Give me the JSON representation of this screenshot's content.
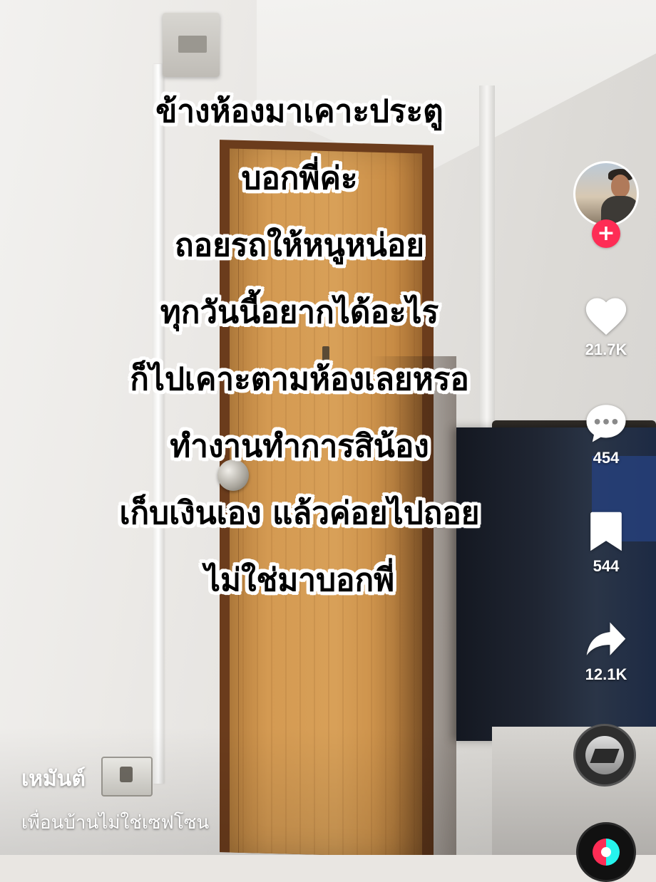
{
  "caption": {
    "lines": [
      "ข้างห้องมาเคาะประตู",
      "บอกพี่ค่ะ",
      "ถอยรถให้หนูหน่อย",
      "ทุกวันนี้อยากได้อะไร",
      "ก็ไปเคาะตามห้องเลยหรอ",
      "ทำงานทำการสิน้อง",
      "เก็บเงินเอง แล้วค่อยไปถอย",
      "ไม่ใช่มาบอกพี่"
    ]
  },
  "actions": {
    "follow_label": "+",
    "likes": "21.7K",
    "comments": "454",
    "bookmarks": "544",
    "shares": "12.1K"
  },
  "post": {
    "username": "เหมันต์",
    "description": "เพื่อนบ้านไม่ใช่เซฟโซน"
  },
  "colors": {
    "follow": "#fe2c55",
    "icon": "#ffffff",
    "text": "#ffffff"
  },
  "icons": [
    "heart-icon",
    "comment-icon",
    "bookmark-icon",
    "share-icon",
    "music-disc",
    "tiktok-badge"
  ]
}
